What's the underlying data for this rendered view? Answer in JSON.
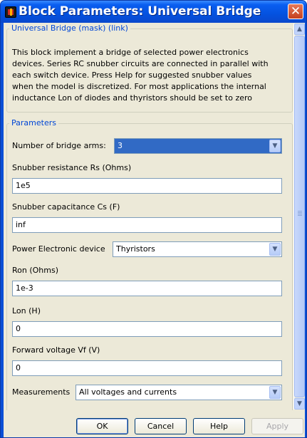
{
  "window": {
    "title": "Block Parameters: Universal Bridge",
    "close_glyph": "✕"
  },
  "mask": {
    "group_title": "Universal Bridge (mask) (link)",
    "description_lines": [
      "This block implement a bridge of selected power electronics",
      "devices.  Series RC snubber circuits are connected in parallel with",
      "each switch device.  Press Help for suggested snubber values",
      "when the model is discretized. For most applications the internal",
      "inductance Lon of diodes and thyristors should be set to zero"
    ]
  },
  "parameters": {
    "group_title": "Parameters",
    "bridge_arms": {
      "label": "Number of bridge arms:",
      "value": "3"
    },
    "snubber_rs": {
      "label": "Snubber resistance Rs (Ohms)",
      "value": "1e5"
    },
    "snubber_cs": {
      "label": "Snubber capacitance Cs (F)",
      "value": "inf"
    },
    "device": {
      "label": "Power Electronic device",
      "value": "Thyristors"
    },
    "ron": {
      "label": "Ron (Ohms)",
      "value": "1e-3"
    },
    "lon": {
      "label": "Lon (H)",
      "value": "0"
    },
    "vf": {
      "label": "Forward voltage Vf (V)",
      "value": "0"
    },
    "measurements": {
      "label": "Measurements",
      "value": "All voltages and currents"
    }
  },
  "buttons": {
    "ok": "OK",
    "cancel": "Cancel",
    "help": "Help",
    "apply": "Apply"
  },
  "icons": {
    "dropdown": "chevron-down-icon",
    "scroll_up": "arrow-up-icon",
    "scroll_down": "arrow-down-icon"
  }
}
